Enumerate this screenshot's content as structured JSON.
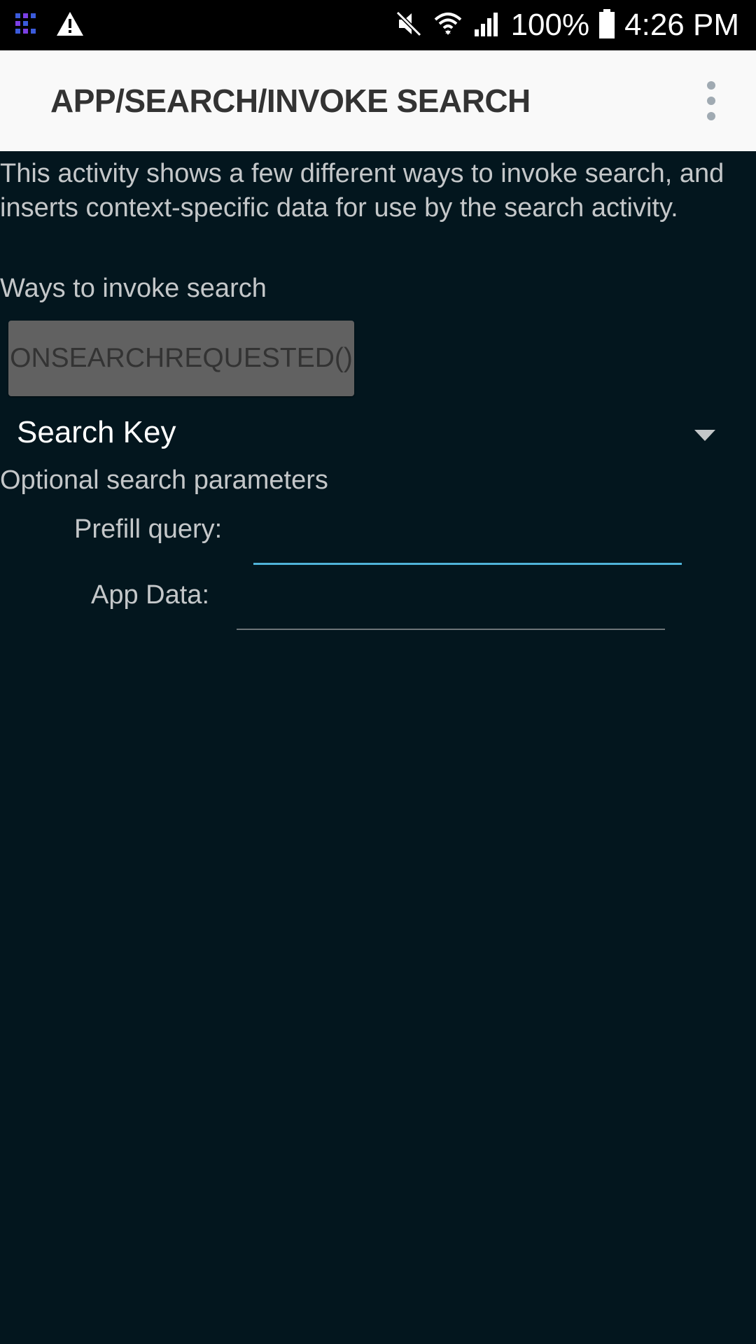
{
  "status_bar": {
    "battery_percent": "100%",
    "time": "4:26 PM",
    "icons": [
      "app-grid-icon",
      "warning-icon",
      "mute-icon",
      "wifi-icon",
      "signal-icon",
      "battery-icon"
    ]
  },
  "app_bar": {
    "title": "APP/SEARCH/INVOKE SEARCH",
    "overflow_icon": "more-vert-icon"
  },
  "main": {
    "description": "This activity shows a few different ways to invoke search, and inserts context-specific data for use by the search activity.",
    "ways_label": "Ways to invoke search",
    "invoke_button_label": "ONSEARCHREQUESTED()",
    "spinner_selected": "Search Key",
    "optional_label": "Optional search parameters",
    "prefill_label": "Prefill query:",
    "prefill_value": "",
    "app_data_label": "App Data:",
    "app_data_value": ""
  },
  "colors": {
    "background": "#03161e",
    "accent": "#4fb3d9",
    "app_bar": "#f9f9f9"
  }
}
